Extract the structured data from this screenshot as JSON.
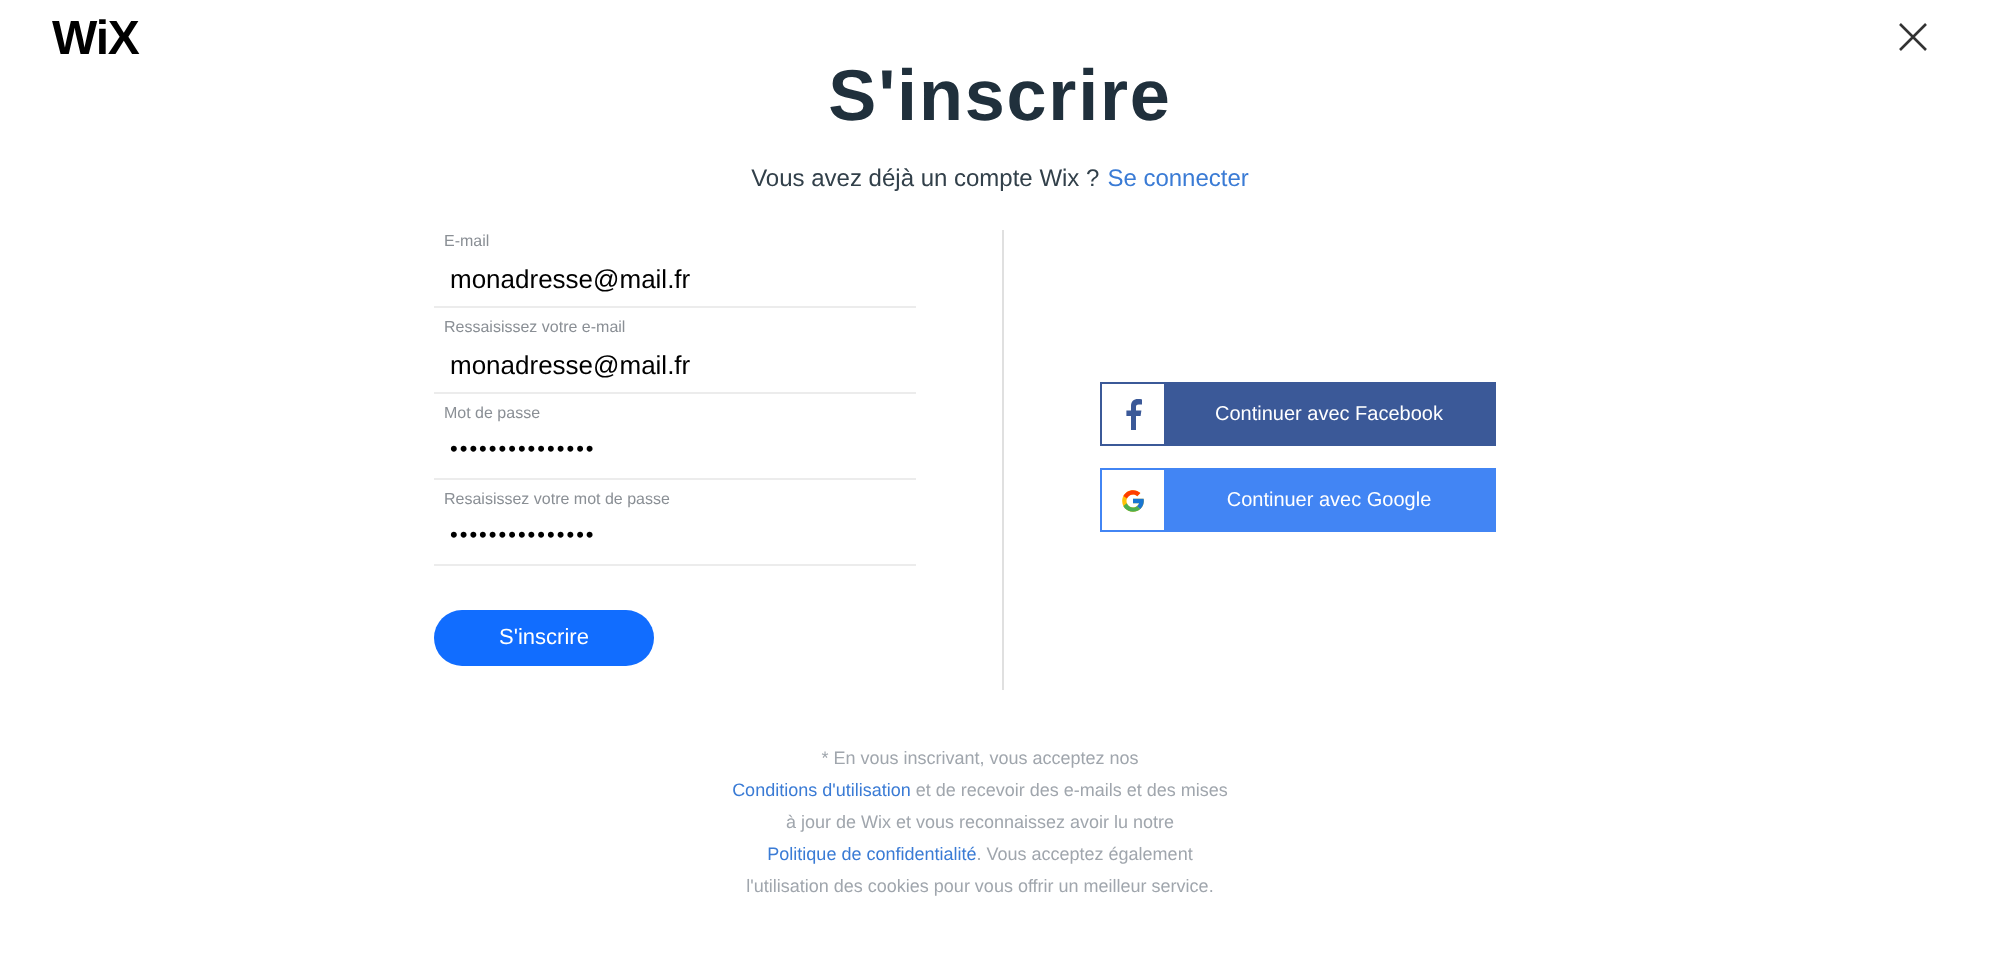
{
  "logo": "WiX",
  "title": "S'inscrire",
  "subtitle": {
    "text": "Vous avez déjà un compte Wix ?",
    "link": "Se connecter"
  },
  "fields": [
    {
      "label": "E-mail",
      "value": "monadresse@mail.fr",
      "kind": "text"
    },
    {
      "label": "Ressaisissez votre e-mail",
      "value": "monadresse@mail.fr",
      "kind": "text"
    },
    {
      "label": "Mot de passe",
      "value": "•••••••••••••••",
      "kind": "password"
    },
    {
      "label": "Resaisissez votre mot de passe",
      "value": "•••••••••••••••",
      "kind": "password"
    }
  ],
  "submit": "S'inscrire",
  "social": [
    {
      "kind": "facebook",
      "label": "Continuer avec Facebook"
    },
    {
      "kind": "google",
      "label": "Continuer avec Google"
    }
  ],
  "notice": [
    {
      "kind": "text",
      "text": "* En vous inscrivant, vous acceptez nos "
    },
    {
      "kind": "link",
      "text": "Conditions d'utilisation"
    },
    {
      "kind": "text",
      "text": " et de recevoir des e-mails et des mises à jour de Wix et vous reconnaissez avoir lu notre "
    },
    {
      "kind": "link",
      "text": "Politique de confidentialité"
    },
    {
      "kind": "text",
      "text": ". Vous acceptez également l'utilisation des cookies pour vous offrir un meilleur service."
    }
  ]
}
